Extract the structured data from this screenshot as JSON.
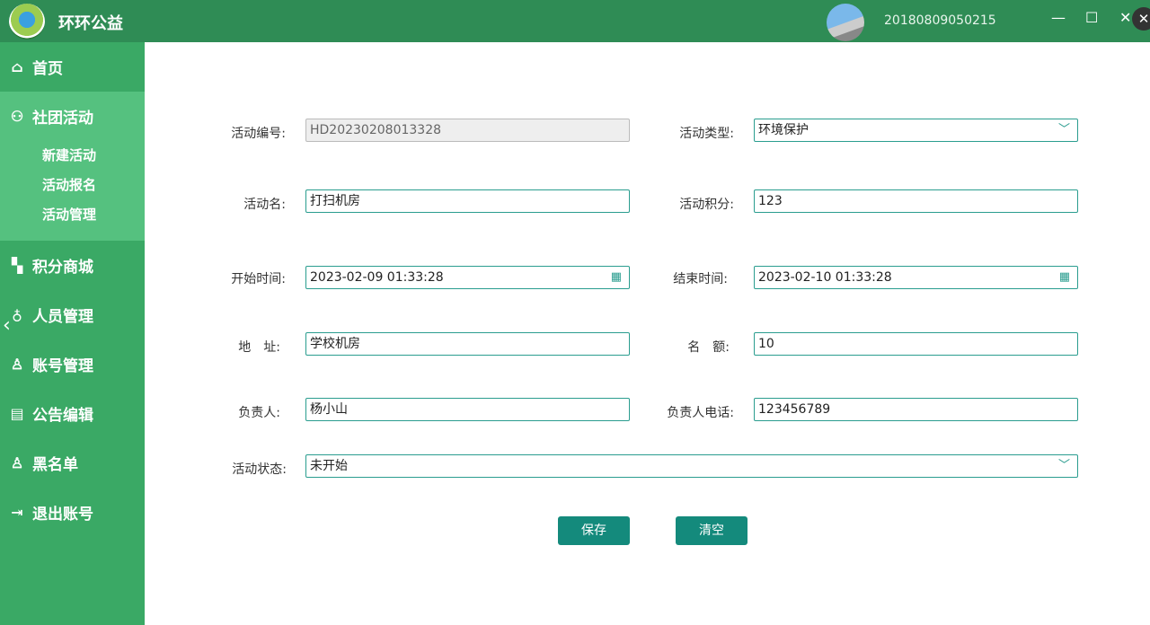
{
  "app": {
    "title": "环环公益",
    "user_id": "20180809050215"
  },
  "window": {
    "minimize": "—",
    "maximize": "☐",
    "close": "✕"
  },
  "sidebar": {
    "items": [
      {
        "label": "首页",
        "icon": "home-icon"
      },
      {
        "label": "社团活动",
        "icon": "group-icon",
        "children": [
          "新建活动",
          "活动报名",
          "活动管理"
        ]
      },
      {
        "label": "积分商城",
        "icon": "grid-icon"
      },
      {
        "label": "人员管理",
        "icon": "users-icon"
      },
      {
        "label": "账号管理",
        "icon": "user-icon"
      },
      {
        "label": "公告编辑",
        "icon": "notice-icon"
      },
      {
        "label": "黑名单",
        "icon": "blacklist-icon"
      },
      {
        "label": "退出账号",
        "icon": "logout-icon"
      }
    ]
  },
  "form": {
    "activity_id": {
      "label": "活动编号:",
      "value": "HD20230208013328"
    },
    "activity_type": {
      "label": "活动类型:",
      "value": "环境保护"
    },
    "activity_name": {
      "label": "活动名:",
      "value": "打扫机房"
    },
    "points": {
      "label": "活动积分:",
      "value": "123"
    },
    "start_time": {
      "label": "开始时间:",
      "value": "2023-02-09 01:33:28"
    },
    "end_time": {
      "label": "结束时间:",
      "value": "2023-02-10 01:33:28"
    },
    "address": {
      "label": "地　址:",
      "value": "学校机房"
    },
    "quota": {
      "label": "名　额:",
      "value": "10"
    },
    "leader": {
      "label": "负责人:",
      "value": "杨小山"
    },
    "phone": {
      "label": "负责人电话:",
      "value": "123456789"
    },
    "status": {
      "label": "活动状态:",
      "value": "未开始"
    }
  },
  "buttons": {
    "save": "保存",
    "clear": "清空"
  }
}
